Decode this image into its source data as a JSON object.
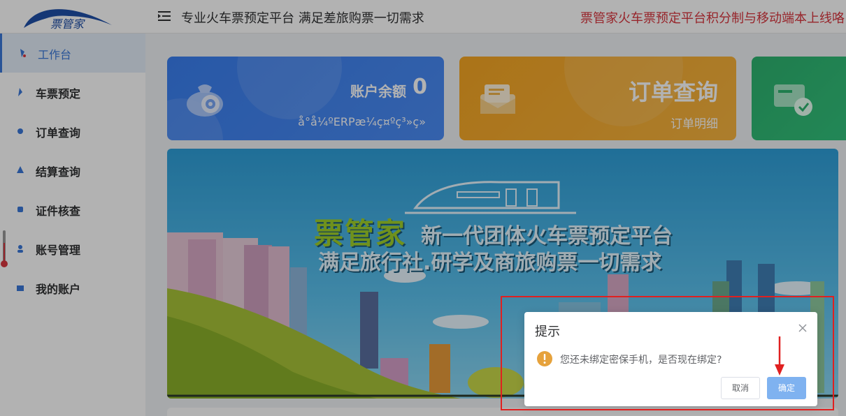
{
  "header": {
    "logo_text": "票管家",
    "platform_title": "专业火车票预定平台 满足差旅购票一切需求",
    "marquee": "票管家火车票预定平台积分制与移动端本上线咯"
  },
  "sidebar": {
    "items": [
      {
        "label": "工作台",
        "active": true
      },
      {
        "label": "车票预定"
      },
      {
        "label": "订单查询"
      },
      {
        "label": "结算查询"
      },
      {
        "label": "证件核查"
      },
      {
        "label": "账号管理"
      },
      {
        "label": "我的账户"
      }
    ]
  },
  "cards": {
    "balance_label": "账户余额",
    "balance_value": "0",
    "balance_garbled": "å°å¼ºERPæ¼ç¤ºç³»ç»",
    "order_title": "订单查询",
    "order_sub": "订单明细"
  },
  "banner": {
    "brand": "票管家",
    "slogan1": "新一代团体火车票预定平台",
    "slogan2": "满足旅行社.研学及商旅购票一切需求"
  },
  "dialog": {
    "title": "提示",
    "message": "您还未绑定密保手机，是否现在绑定?",
    "cancel_label": "取消",
    "ok_label": "确定"
  },
  "colors": {
    "accent": "#3a78d8",
    "marquee": "#d9363e",
    "highlight": "#e02020",
    "ok_button": "#7fb2f0"
  }
}
